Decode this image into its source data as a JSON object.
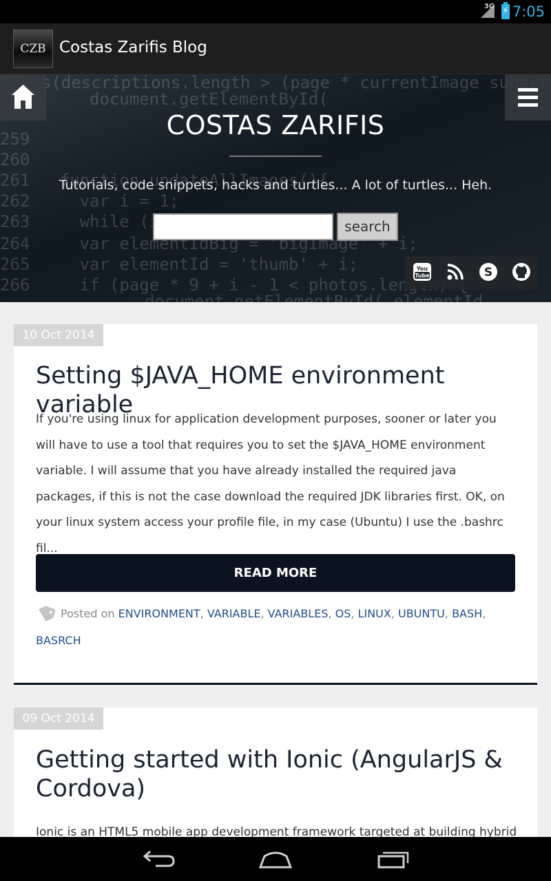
{
  "status_bar": {
    "network": "3G",
    "time": "7:05",
    "icons": [
      "signal-icon",
      "battery-charging-icon"
    ]
  },
  "app_bar": {
    "logo_text": "CZB",
    "title": "Costas Zarifis Blog"
  },
  "hero": {
    "site_title": "COSTAS ZARIFIS",
    "tagline": "Tutorials, code snippets, hacks and turtles... A lot of turtles... Heh.",
    "search": {
      "value": "",
      "placeholder": "",
      "button_label": "search"
    },
    "social_icons": [
      "youtube-icon",
      "rss-icon",
      "skype-icon",
      "github-icon"
    ],
    "social_youtube_text": "You Tube"
  },
  "posts": [
    {
      "date": "10 Oct 2014",
      "title": "Setting $JAVA_HOME environment variable",
      "excerpt": "If you're using linux for application development purposes, sooner or later you will have to use a tool that requires you to set the $JAVA_HOME environment variable. I will assume that you have already installed the required java packages, if this is not the case download the required JDK libraries first. OK, on your linux system access your profile file, in my case (Ubuntu) I use the .bashrc fil...",
      "read_more": "READ MORE",
      "posted_on": "Posted on",
      "tags": [
        "ENVIRONMENT",
        "VARIABLE",
        "VARIABLES",
        "OS",
        "LINUX",
        "UBUNTU",
        "BASH",
        "BASRCH"
      ]
    },
    {
      "date": "09 Oct 2014",
      "title": "Getting started with Ionic (AngularJS & Cordova)",
      "excerpt": "Ionic is an HTML5 mobile app development framework targeted at building hybrid"
    }
  ],
  "colors": {
    "status_accent": "#33b5e5",
    "app_bar": "#1e1e1e",
    "read_more_bg": "#0b1320",
    "tag_link": "#214d8c",
    "date_badge": "#d6d6d6"
  },
  "nav_bar": [
    "back-icon",
    "home-icon",
    "recent-apps-icon"
  ]
}
